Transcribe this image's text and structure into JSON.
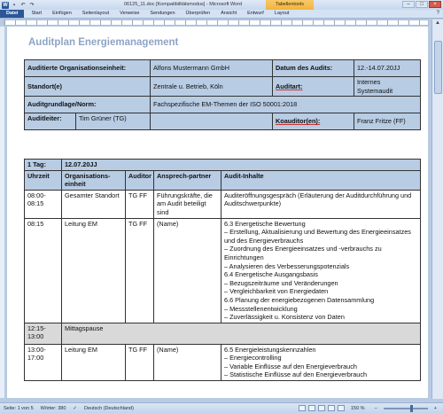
{
  "window": {
    "title": "06125_11.doc [Kompatibilitätsmodus] - Microsoft Word",
    "context_tab": "Tabellentools",
    "accent": "#2b5797"
  },
  "ribbon": {
    "tabs": [
      "Datei",
      "Start",
      "Einfügen",
      "Seitenlayout",
      "Verweise",
      "Sendungen",
      "Überprüfen",
      "Ansicht",
      "Entwurf",
      "Layout"
    ]
  },
  "document": {
    "title": "Auditplan Energiemanagement",
    "info": {
      "org_label": "Auditierte Organisationseinheit:",
      "org_value": "Alfons Mustermann GmbH",
      "date_label": "Datum des Audits:",
      "date_value": "12.-14.07.20JJ",
      "site_label": "Standort(e)",
      "site_value": "Zentrale u. Betrieb, Köln",
      "type_label": "Auditart:",
      "type_value": "Internes Systemaudit",
      "basis_label": "Auditgrundlage/Norm:",
      "basis_value": "Fachspezifische EM-Themen der ISO 50001:2018",
      "lead_label": "Auditleiter:",
      "lead_value": "Tim Grüner (TG)",
      "coauditor_label": "Koauditor(en):",
      "coauditor_value": "Franz Fritze (FF)"
    },
    "schedule": {
      "day_label": "1 Tag:",
      "day_date": "12.07.20JJ",
      "headers": [
        "Uhrzeit",
        "Organisations-einheit",
        "Auditor",
        "Ansprech-partner",
        "Audit-Inhalte"
      ],
      "rows": [
        {
          "time": "08:00-08:15",
          "unit": "Gesamter Standort",
          "auditor": "TG FF",
          "contact": "Führungskräfte, die am Audit beteiligt sind",
          "content": "Auditeröffnungsgespräch (Erläuterung der Auditdurchführung und Auditschwerpunkte)"
        },
        {
          "time": "08:15",
          "unit": "Leitung EM",
          "auditor": "TG FF",
          "contact": "(Name)",
          "content": "6.3 Energetische Bewertung\n– Erstellung, Aktualisierung und Bewertung des Energieeinsatzes und des Energieverbrauchs\n– Zuordnung des Energieeinsatzes und -verbrauchs zu Einrichtungen\n– Analysieren des Verbesserungspotenzials\n6.4 Energetische Ausgangsbasis\n– Bezugszeiträume und Veränderungen\n– Vergleichbarkeit von Energiedaten\n6.6 Planung der energiebezogenen Datensammlung\n– Messstellenentwicklung\n– Zuverlässigkeit u. Konsistenz von Daten"
        },
        {
          "time": "12:15-13:00",
          "unit": "Mittagspause"
        },
        {
          "time": "13:00-17:00",
          "unit": "Leitung EM",
          "auditor": "TG FF",
          "contact": "(Name)",
          "content": "6.5 Energieleistungskennzahlen\n– Energiecontrolling\n– Variable Einflüsse auf den Energieverbrauch\n– Statistische Einflüsse auf den Energieverbrauch"
        }
      ]
    }
  },
  "statusbar": {
    "page": "Seite: 1 von 5",
    "words": "Wörter: 380",
    "language": "Deutsch (Deutschland)",
    "zoom": "150 %"
  }
}
